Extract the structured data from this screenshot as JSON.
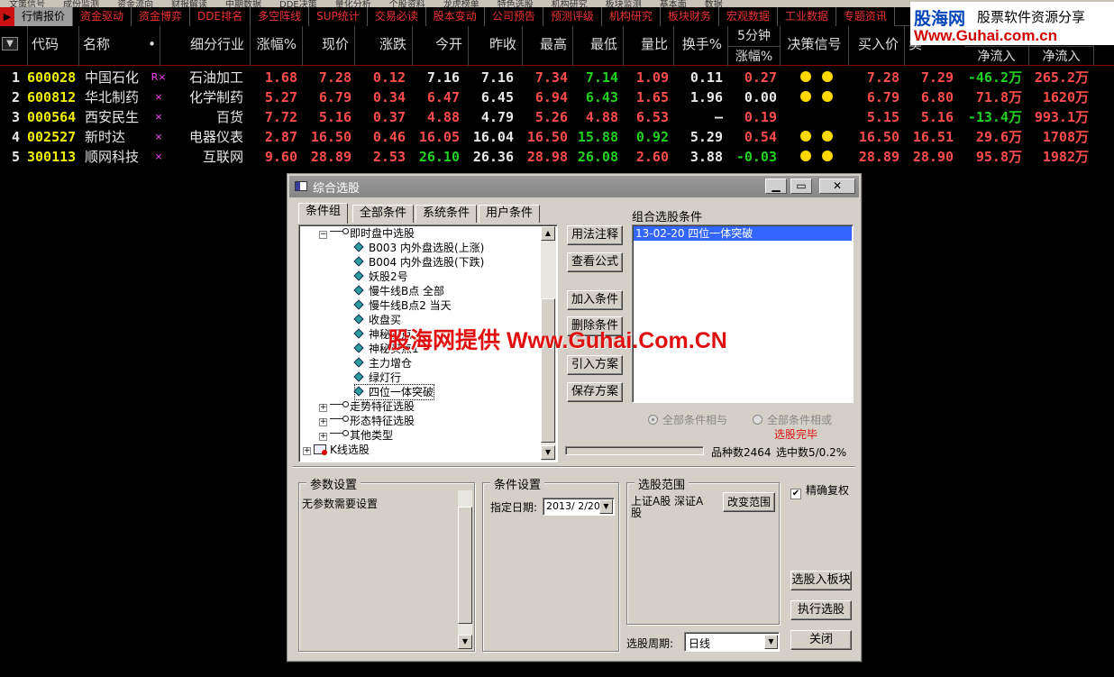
{
  "top_strip": [
    "文策信号",
    "成份监测",
    "资金流向",
    "财报解读",
    "中期数据",
    "DDE决策",
    "量化分析",
    "个股资料",
    "龙虎榜单",
    "特色选股",
    "机构研究",
    "板块监测",
    "基本面",
    "数据"
  ],
  "tabs": [
    "行情报价",
    "资金驱动",
    "资金博弈",
    "DDE排名",
    "多空阵线",
    "SUP统计",
    "交易必读",
    "股本变动",
    "公司预告",
    "预测评级",
    "机构研究",
    "板块财务",
    "宏观数据",
    "工业数据",
    "专题资讯"
  ],
  "logo": {
    "name": "股海网",
    "slogan": "股票软件资源分享",
    "url": "Www.Guhai.com.cn"
  },
  "header": {
    "code": "代码",
    "name": "名称",
    "marker": "•",
    "industry": "细分行业",
    "pct": "涨幅%",
    "price": "现价",
    "change": "涨跌",
    "open": "今开",
    "prev_close": "昨收",
    "high": "最高",
    "low": "最低",
    "vol_ratio": "量比",
    "turnover": "换手%",
    "min5_top": "5分钟",
    "min5_bottom": "涨幅%",
    "signal": "决策信号",
    "bid": "买入价",
    "ask": "卖",
    "inflow1": "净流入",
    "inflow2": "净流入"
  },
  "rows": [
    {
      "idx": "1",
      "code": "600028",
      "name": "中国石化",
      "flag": "R×",
      "industry": "石油加工",
      "pct": "1.68",
      "price": "7.28",
      "change": "0.12",
      "open": "7.16",
      "prev": "7.16",
      "high": "7.34",
      "low": "7.14",
      "vr": "1.09",
      "turn": "0.11",
      "min5": "0.27",
      "bid": "7.28",
      "ask": "7.29",
      "in1": "-46.2万",
      "in2": "265.2万",
      "dots": 2
    },
    {
      "idx": "2",
      "code": "600812",
      "name": "华北制药",
      "flag": "×",
      "industry": "化学制药",
      "pct": "5.27",
      "price": "6.79",
      "change": "0.34",
      "open": "6.47",
      "prev": "6.45",
      "high": "6.94",
      "low": "6.43",
      "vr": "1.65",
      "turn": "1.96",
      "min5": "0.00",
      "bid": "6.79",
      "ask": "6.80",
      "in1": "71.8万",
      "in2": "1620万",
      "dots": 2
    },
    {
      "idx": "3",
      "code": "000564",
      "name": "西安民生",
      "flag": "×",
      "industry": "百货",
      "pct": "7.72",
      "price": "5.16",
      "change": "0.37",
      "open": "4.88",
      "prev": "4.79",
      "high": "5.26",
      "low": "4.88",
      "vr": "6.53",
      "turn": "—",
      "min5": "0.19",
      "bid": "5.15",
      "ask": "5.16",
      "in1": "-13.4万",
      "in2": "993.1万",
      "dots": 0
    },
    {
      "idx": "4",
      "code": "002527",
      "name": "新时达",
      "flag": "×",
      "industry": "电器仪表",
      "pct": "2.87",
      "price": "16.50",
      "change": "0.46",
      "open": "16.05",
      "prev": "16.04",
      "high": "16.50",
      "low": "15.88",
      "vr": "0.92",
      "turn": "5.29",
      "min5": "0.54",
      "bid": "16.50",
      "ask": "16.51",
      "in1": "29.6万",
      "in2": "1708万",
      "dots": 2
    },
    {
      "idx": "5",
      "code": "300113",
      "name": "顺网科技",
      "flag": "×",
      "industry": "互联网",
      "pct": "9.60",
      "price": "28.89",
      "change": "2.53",
      "open": "26.10",
      "prev": "26.36",
      "high": "28.98",
      "low": "26.08",
      "vr": "2.60",
      "turn": "3.88",
      "min5": "-0.03",
      "bid": "28.89",
      "ask": "28.90",
      "in1": "95.8万",
      "in2": "1982万",
      "dots": 2
    }
  ],
  "dialog": {
    "title": "综合选股",
    "tabs": [
      "条件组",
      "全部条件",
      "系统条件",
      "用户条件"
    ],
    "tree": {
      "root": "即时盘中选股",
      "leaves": [
        "B003 内外盘选股(上涨)",
        "B004 内外盘选股(下跌)",
        "妖股2号",
        "慢牛线B点 全部",
        "慢牛线B点2 当天",
        "收盘买",
        "神秘买点",
        "神秘买点1",
        "主力增仓",
        "绿灯行",
        "四位一体突破"
      ],
      "groups": [
        "走势特征选股",
        "形态特征选股",
        "其他类型"
      ],
      "kline": "K线选股"
    },
    "buttons": {
      "usage": "用法注释",
      "formula": "查看公式",
      "add": "加入条件",
      "delete": "删除条件",
      "import": "引入方案",
      "save": "保存方案"
    },
    "combo_label": "组合选股条件",
    "combo_items": [
      "13-02-20 四位一体突破"
    ],
    "radio_and": "全部条件相与",
    "radio_or": "全部条件相或",
    "status": "选股完毕",
    "count_label": "品种数2464",
    "selected_label": "选中数5/0.2%",
    "param_title": "参数设置",
    "param_text": "无参数需要设置",
    "cond_title": "条件设置",
    "date_label": "指定日期:",
    "date_value": "2013/ 2/20",
    "range_title": "选股范围",
    "range_text": "上证A股 深证A股",
    "change_range": "改变范围",
    "exact_label": "精确复权",
    "to_block": "选股入板块",
    "run": "执行选股",
    "period_label": "选股周期:",
    "period_value": "日线",
    "close": "关闭"
  },
  "watermark": "股海网提供 Www.Guhai.Com.CN"
}
